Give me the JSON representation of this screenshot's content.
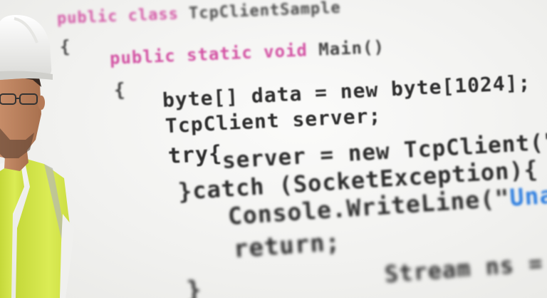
{
  "code": {
    "line1": {
      "kw": "public class",
      "rest": " TcpClientSample"
    },
    "line2": "{",
    "line3": {
      "kw": "public static void",
      "rest": " Main()"
    },
    "line4": "{",
    "line5": "byte[] data = new byte[1024];",
    "line6": "TcpClient server;",
    "line7": "try{",
    "line8": "server = new TcpClient(\"",
    "line9": "}catch (SocketException){",
    "line10": {
      "pre": "Console.WriteLine(\"",
      "str": "Unab"
    },
    "line11": "return;",
    "line12": "}",
    "line13": "Stream ns = server"
  },
  "colors": {
    "keyword": "#cf3f9a",
    "string": "#2f7fe0",
    "code_text": "#2e2e2e",
    "vest": "#d6e84a",
    "helmet": "#f3f3f1"
  },
  "subjects": {
    "person": "construction-worker-with-helmet-and-safety-vest"
  }
}
